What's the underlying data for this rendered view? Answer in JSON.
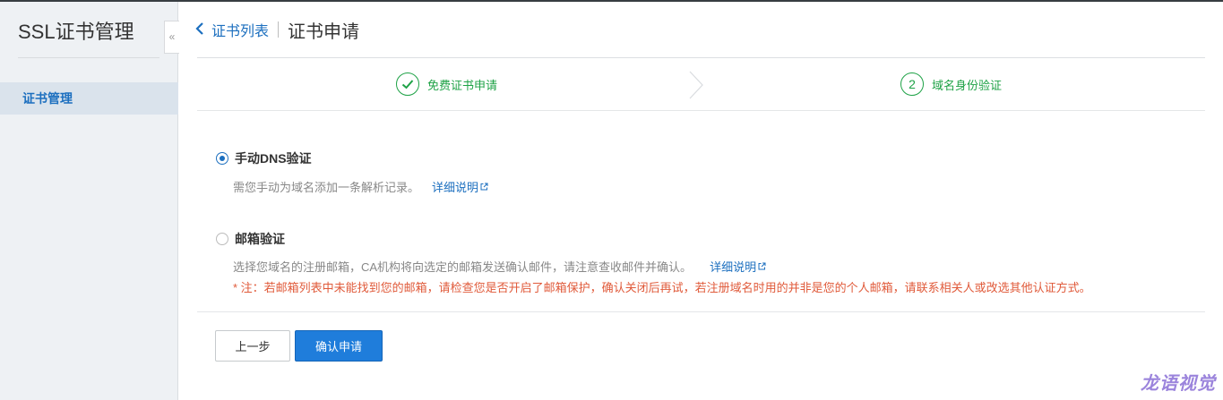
{
  "sidebar": {
    "title": "SSL证书管理",
    "collapse_glyph": "«",
    "items": [
      {
        "label": "证书管理",
        "active": true
      }
    ]
  },
  "header": {
    "back_label": "证书列表",
    "title": "证书申请"
  },
  "steps": [
    {
      "number": "✓",
      "label": "免费证书申请",
      "state": "done"
    },
    {
      "number": "2",
      "label": "域名身份验证",
      "state": "current"
    }
  ],
  "options": {
    "dns": {
      "label": "手动DNS验证",
      "checked": true,
      "description": "需您手动为域名添加一条解析记录。",
      "link": "详细说明"
    },
    "email": {
      "label": "邮箱验证",
      "checked": false,
      "description": "选择您域名的注册邮箱，CA机构将向选定的邮箱发送确认邮件，请注意查收邮件并确认。",
      "link": "详细说明",
      "note": "* 注：若邮箱列表中未能找到您的邮箱，请检查您是否开启了邮箱保护，确认关闭后再试，若注册域名时用的并非是您的个人邮箱，请联系相关人或改选其他认证方式。"
    }
  },
  "actions": {
    "prev_label": "上一步",
    "confirm_label": "确认申请"
  },
  "watermark": "龙语视觉",
  "colors": {
    "accent": "#1c6fbf",
    "success": "#1ea246",
    "primary_button": "#1f7ddb",
    "note": "#e05a3a"
  }
}
